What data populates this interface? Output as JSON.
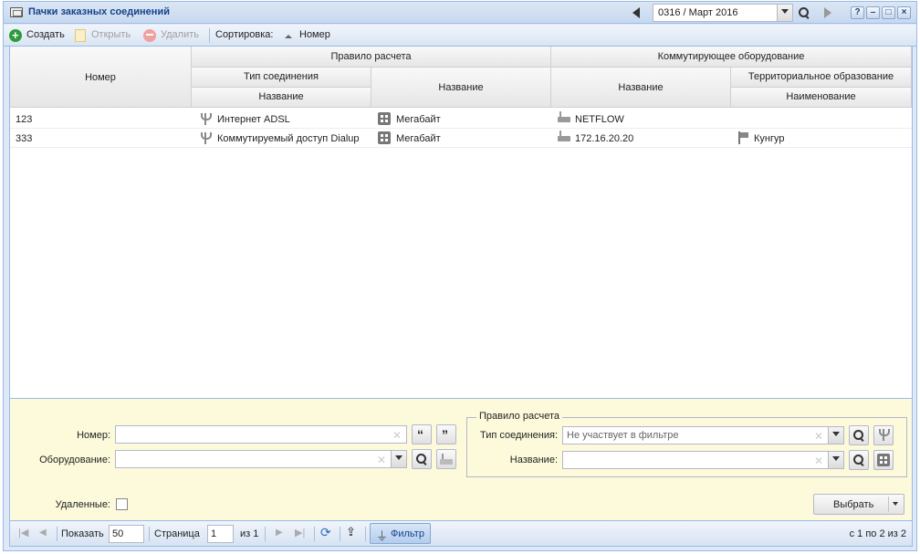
{
  "window": {
    "title": "Пачки заказных соединений"
  },
  "period": {
    "value": "0316 / Март 2016"
  },
  "toolbar": {
    "create": "Создать",
    "open": "Открыть",
    "delete": "Удалить",
    "sort_label": "Сортировка:",
    "sort_field": "Номер"
  },
  "columns": {
    "number": "Номер",
    "rule_group": "Правило расчета",
    "conn_type_group": "Тип соединения",
    "conn_type_name": "Название",
    "rule_name": "Название",
    "equipment_group": "Коммутирующее оборудование",
    "equipment_name": "Название",
    "territory_group": "Территориальное образование",
    "territory_name": "Наименование"
  },
  "rows": [
    {
      "number": "123",
      "conn_type": "Интернет ADSL",
      "rule": "Мегабайт",
      "equipment": "NETFLOW",
      "territory": ""
    },
    {
      "number": "333",
      "conn_type": "Коммутируемый доступ Dialup",
      "rule": "Мегабайт",
      "equipment": "172.16.20.20",
      "territory": "Кунгур"
    }
  ],
  "filter": {
    "number_label": "Номер:",
    "equipment_label": "Оборудование:",
    "rule_legend": "Правило расчета",
    "conn_type_label": "Тип соединения:",
    "conn_type_placeholder": "Не участвует в фильтре",
    "name_label": "Название:",
    "deleted_label": "Удаленные:",
    "select_button": "Выбрать"
  },
  "pager": {
    "show_label": "Показать",
    "page_size": "50",
    "page_label": "Страница",
    "page": "1",
    "of_label": "из 1",
    "filter_button": "Фильтр",
    "summary": "с 1 по 2 из 2"
  },
  "colors": {
    "header": "#15428b",
    "border": "#99bbe8",
    "filter_bg": "#fcfadb"
  }
}
